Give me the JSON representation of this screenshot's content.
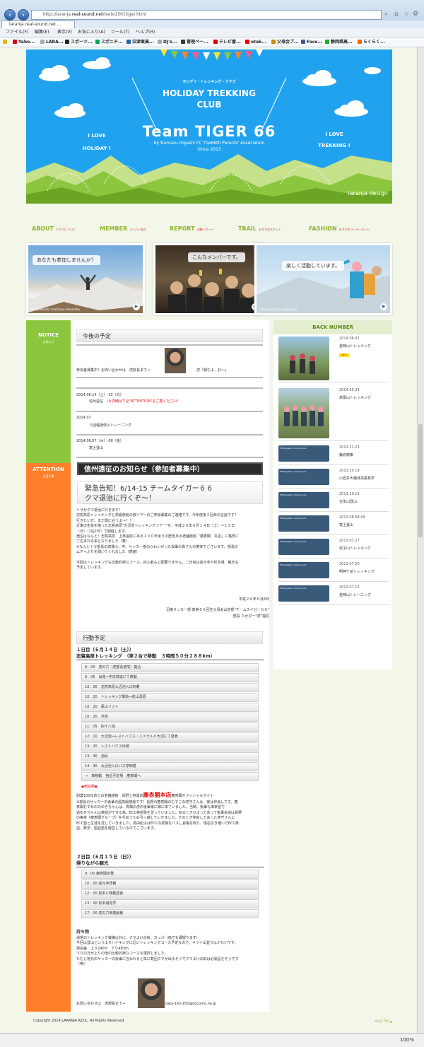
{
  "browser": {
    "url_prefix": "http://laranja.",
    "url_domain": "real-sound.net",
    "url_path": "/leote1501tiger.html",
    "tab_title": "laranja.real-sound.net ...",
    "menu": [
      "ファイル(F)",
      "編集(E)",
      "表示(V)",
      "お気に入り(A)",
      "ツール(T)",
      "ヘルプ(H)"
    ],
    "favorites": [
      "Yaho...",
      "LARA...",
      "スポーツ...",
      "スポニチ...",
      "沼津東高...",
      "DJ's...",
      "管理ペー...",
      "テレビ番...",
      "otak...",
      "父母会ブ...",
      "Face...",
      "静岡県高...",
      "らくらく..."
    ],
    "status_zoom": "100%"
  },
  "header": {
    "kana": "ホリデイ・トレッキング・クラブ",
    "club_line1": "HOLIDAY TREKKING",
    "club_line2": "CLUB",
    "love_left_1": "I LOVE",
    "love_left_2": "HOLIDAY !",
    "love_right_1": "I LOVE",
    "love_right_2": "TREKKING !",
    "team": "Team TIGER 66",
    "by": "by Numazu Higashi FC The66th Parents' Association",
    "since": "Since 2013",
    "logo": "laranja design"
  },
  "nav": [
    {
      "label": "ABOUT",
      "sub": "クラブについて"
    },
    {
      "label": "MEMBER",
      "sub": "メンバー紹介"
    },
    {
      "label": "REPORT",
      "sub": "活動レポート"
    },
    {
      "label": "TRAIL",
      "sub": "おすすめスポット"
    },
    {
      "label": "FASHION",
      "sub": "おすすめコーディネート"
    }
  ],
  "photos": [
    {
      "caption": "あなたも参加しませんか？",
      "credit": "©iStockphoto.com/Sava Alexandru"
    },
    {
      "caption": "こんなメンバーです。",
      "credit": ""
    },
    {
      "caption": "楽しく活動しています。",
      "credit": "©iStockphoto.com/gaspr13"
    }
  ],
  "notice": {
    "label": "NOTICE",
    "sub": "お知らせ",
    "title": "今後の予定",
    "contact": "参加者募集中！お問い合わせは　虎部長まで→",
    "contact_quote": "虎「頼むよ、お〜」",
    "events": [
      {
        "date": "2014.06.14（土）-15（日）",
        "name": "信州遠征",
        "note": "（※詳細は下記\"ATTENTION\"をご覧ください）"
      },
      {
        "date": "2014.07",
        "name": "３回程度低山トレーニング",
        "note": ""
      },
      {
        "date": "2014.08.07（木）-08（金）",
        "name": "富士登山",
        "note": ""
      }
    ]
  },
  "attention": {
    "label": "ATTENTION",
    "sub": "注目行事",
    "banner": "信州遠征のお知らせ（参加者募集中）",
    "urgent_1": "緊急告知！6/14-15 チームタイガー６６",
    "urgent_2": "クマ退治に行くぞ〜！",
    "body": [
      "トラがクマ退治に行きます！",
      "志賀高原トレッキングと高級旅館の旅ツアーのご参加募集のご連絡です。今年度第３回目の企画です！",
      "行きたい方、まだ間に合うよ〜！！",
      "近東の生徒を擁った志賀高原\"大沼池トレッキングツアー\"を、平成２６年６月１４日（土）～１５日",
      "（日）（1泊2日）で開催します。",
      "宿泊はなんと！志賀高原　上林温泉にある１００年余りの歴史ある老舗旅館「塵表閣　本店」に格安に",
      "て泊まれる事となりました（驚）",
      "※なんとトラ部長の高橋小、中、サッカー部のかわいがった後輩の貴さんの実家でございます。部長の",
      "ムチャぶりを聞いてくれました（感謝）",
      "",
      "今回はトレッキングも比較的楽なコース。初心者も心配要りません。二日目は高元寺や松本城　観光も",
      "予定しています。"
    ],
    "sign_date": "平成２６年６月6日",
    "sign_org": "沼東サッカー部 高第６６回生父母会山岳部\"チームタイガー６６\"",
    "sign_name": "部長 たかぴー\"虎\"福島",
    "plan_title": "行動予定",
    "day1_title_1": "１日目（６月１４日（土））",
    "day1_title_2": "志賀高原トレッキング　（車２台で移動　３時間５０分２８８km）",
    "day1": [
      "6：00　虎の穴（虎部長宿宅）集合",
      "6：05　出発→中央高速にて移動",
      "10：00　志賀高原大沼池入口到着",
      "10：20　トレッキング開始→前山湿原",
      "10：20　蓮山リフト",
      "10：20　渋池",
      "11：05　四十八池",
      "12：10　大沼池→レストハウス・エメラルド大沼にて昼食",
      "13：20　レストハウス出発",
      "13：40　池尻",
      "14：30　大沼池入口バス停到着",
      "→　車移動　宿泊予定場　塵表閣へ"
    ],
    "inn_label": "◆宿泊場◆",
    "inn_prefix": "創業100年余りの老舗旅館　長野上林温泉",
    "inn_name": "塵表閣本店",
    "inn_suffix": "塵表閣オフィシャルサイト",
    "inn_body": [
      "※部長のサッカーの後輩の超高級旅館です！長野の塵表閣のむすこの虎守さんは、実は仲良しです。塵",
      "表閣むすめのみゆきちゃんは、高橋の虎の後輩家に嫁に来ていました。当時、後輩も田家屋で",
      "過ゆきちゃんは英語ができる為、ECC英語塾を習っていました。あるときひよってあって後輩夫婦は長野",
      "の実家（塵表閣グループ）を手伝うため引っ越していきました。そのとき仲良しであった虎守さんに",
      "ECC塾と生徒を託していきました。虎由紀子はECCの試験をパスし資格を取り、現在引き継いでECC英",
      "語、数学、国語塾を経営しているのでございます。"
    ],
    "day2_title_1": "２日目（６月１５日（日））",
    "day2_title_2": "帰りながら観光",
    "day2": [
      "9：00 塵表閣出発",
      "10：00 高元寺拝観",
      "12：00 松本に移動昼食",
      "13：00 松本城見学",
      "17：00 虎の穴到着解散"
    ],
    "items_title": "持ち物",
    "items_body": [
      "通常のトレッキング装備以外に、クマよけの鈴、カッパ（雨でも細望ります）",
      "今回は登山というよりハイキングに近いトレッキングコース予定なので、キツイ山登りは少ないです。",
      "標高差　上り240m　下り483m",
      "下りの方が上りの倍の比較的楽なコースを選択しました。",
      "ただし地元のサッカーの後輩に言われると年に数回クマが出るそうでクマよけの鈴は必需品だそうです",
      "（怖）"
    ],
    "contact2": "お問い合わせは　虎部長まで→",
    "contact2_email": "taka-16v-155@docomo.ne.jp"
  },
  "back_number": {
    "title": "BACK NUMBER",
    "items": [
      {
        "date": "2014.06.01",
        "title": "金時山トレッキング",
        "new": "NEW"
      },
      {
        "date": "2014.05.24",
        "title": "高尾山トレッキング",
        "new": ""
      },
      {
        "date": "2013.11.23",
        "title": "鎌倉散策",
        "new": ""
      },
      {
        "date": "2013.10.19",
        "title": "小岩井大幡耳高展見学",
        "new": ""
      },
      {
        "date": "2013.10.13",
        "title": "宝永山登山",
        "new": ""
      },
      {
        "date": "2013.08.08-09",
        "title": "富士登山",
        "new": ""
      },
      {
        "date": "2013.07.27",
        "title": "双子山トレッキング",
        "new": ""
      },
      {
        "date": "2013.07.20",
        "title": "明神ケ岳トレッキング",
        "new": ""
      },
      {
        "date": "2013.07.13",
        "title": "金時山トレーニング",
        "new": ""
      }
    ],
    "thumb_label": "Photograph coming soon"
  },
  "footer": {
    "copyright": "Copyright 2014 LARANJA AZUL. All Rights Reserved.",
    "page_top": "PAGE TOP ▲"
  }
}
